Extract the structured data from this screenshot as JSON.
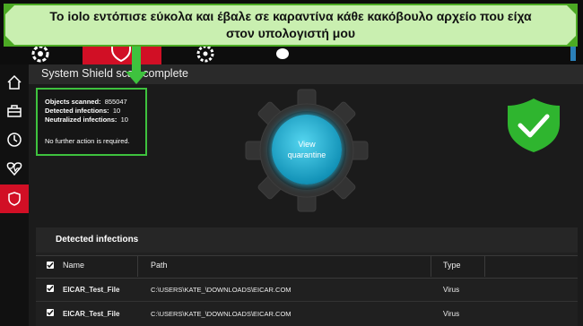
{
  "banner": {
    "text": "Το iolo εντόπισε εύκολα και έβαλε σε καραντίνα κάθε κακόβουλο αρχείο που είχα στον υπολογιστή μου"
  },
  "title": "System Shield scan complete",
  "stats": {
    "objects_label": "Objects scanned:",
    "objects_value": "855047",
    "detected_label": "Detected infections:",
    "detected_value": "10",
    "neutralized_label": "Neutralized infections:",
    "neutralized_value": "10",
    "note": "No further action is required."
  },
  "quarantine_button": {
    "line1": "View",
    "line2": "quarantine"
  },
  "infections": {
    "title": "Detected infections",
    "columns": {
      "name": "Name",
      "path": "Path",
      "type": "Type"
    },
    "rows": [
      {
        "name": "EICAR_Test_File",
        "path": "C:\\USERS\\KATE_\\DOWNLOADS\\EICAR.COM",
        "type": "Virus"
      },
      {
        "name": "EICAR_Test_File",
        "path": "C:\\USERS\\KATE_\\DOWNLOADS\\EICAR.COM",
        "type": "Virus"
      }
    ]
  },
  "sidebar": {
    "items": [
      "home-icon",
      "briefcase-icon",
      "clock-icon",
      "heartbeat-icon",
      "shield-icon"
    ]
  },
  "colors": {
    "accent_red": "#d10f25",
    "highlight_green": "#3ec23e",
    "shield_green": "#2fb52f",
    "button_cyan": "#1393b8"
  }
}
